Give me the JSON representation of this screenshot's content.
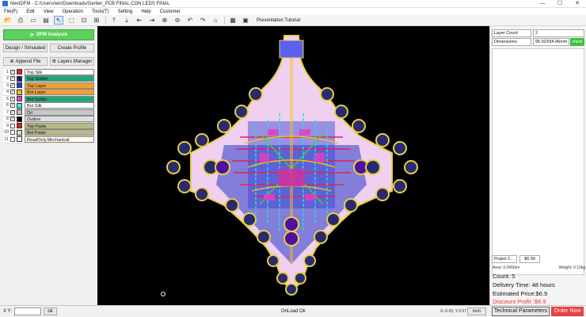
{
  "window": {
    "title": "NextDFM - C:/Users/win/Downloads/Gerber_PCB FINAL CON LEDS FINAL",
    "min": "—",
    "max": "☐",
    "close": "✕"
  },
  "menu": [
    "File(F)",
    "Edit",
    "View",
    "Operation",
    "Tools(T)",
    "Setting",
    "Help",
    "Customer"
  ],
  "toolbar": {
    "mode_label": "Presentation Tutorial"
  },
  "left": {
    "dfm_button": "DFM Analysis",
    "design_button": "Design / Simulated",
    "create_profile_button": "Create Profile",
    "append_file_button": "Append File",
    "layers_manager_button": "Layers Manager",
    "layers": [
      {
        "num": "1",
        "name": "Top Silk",
        "swatch": "#e02020",
        "bg": "#ffffff",
        "check": "✓"
      },
      {
        "num": "2",
        "name": "Top Solder",
        "swatch": "#1a1a80",
        "bg": "#1fa97a",
        "check": "✓"
      },
      {
        "num": "3",
        "name": "Top Layer",
        "swatch": "#2040e0",
        "bg": "#f0a030",
        "check": "✓"
      },
      {
        "num": "4",
        "name": "Bot Layer",
        "swatch": "#f0c020",
        "bg": "#f0a030",
        "check": "✓"
      },
      {
        "num": "5",
        "name": "Bot Solder",
        "swatch": "#e040e0",
        "bg": "#1fa97a",
        "check": "✓"
      },
      {
        "num": "6",
        "name": "Bot Silk",
        "swatch": "#40e0ff",
        "bg": "#ffffff",
        "check": "✓"
      },
      {
        "num": "7",
        "name": "Drl",
        "swatch": "#c0c0c0",
        "bg": "#c8c8c8",
        "check": "✓"
      },
      {
        "num": "8",
        "name": "Outline",
        "swatch": "#000000",
        "bg": "#e0e0e0",
        "check": "✓"
      },
      {
        "num": "9",
        "name": "Top Paste",
        "swatch": "#e02020",
        "bg": "#b8b888",
        "check": ""
      },
      {
        "num": "10",
        "name": "Bot Paste",
        "swatch": "#e0e0a0",
        "bg": "#b8b888",
        "check": ""
      },
      {
        "num": "11",
        "name": "ReadOnly.Mechanical",
        "swatch": "#ffffff",
        "bg": "#ffffee",
        "check": ""
      }
    ]
  },
  "right": {
    "layer_count_label": "Layer Count",
    "layer_count_value": "2",
    "dimensions_label": "Dimensions",
    "dimensions_value": "95.92X94.96mm",
    "check_button": "check",
    "project_cost_label": "Project C...",
    "project_cost_value": "$6.90",
    "area": "Area: 0.0456m²",
    "weight": "Weight: 0.13kg",
    "count": "Count: 5",
    "delivery": "Delivery Time: 48 hours",
    "estimated": "Estimated Price:$6.9",
    "discount": "Discount Profit :$6.9"
  },
  "status": {
    "xy_label": "X Y:",
    "xy_value": "",
    "ok_button": "ok",
    "status_text": "OnLoad Ok",
    "coords": "X:-0.93, Y:3.57",
    "unit_button": "Inch",
    "tech_button": "Technical Parameters",
    "order_button": "Order Now"
  }
}
